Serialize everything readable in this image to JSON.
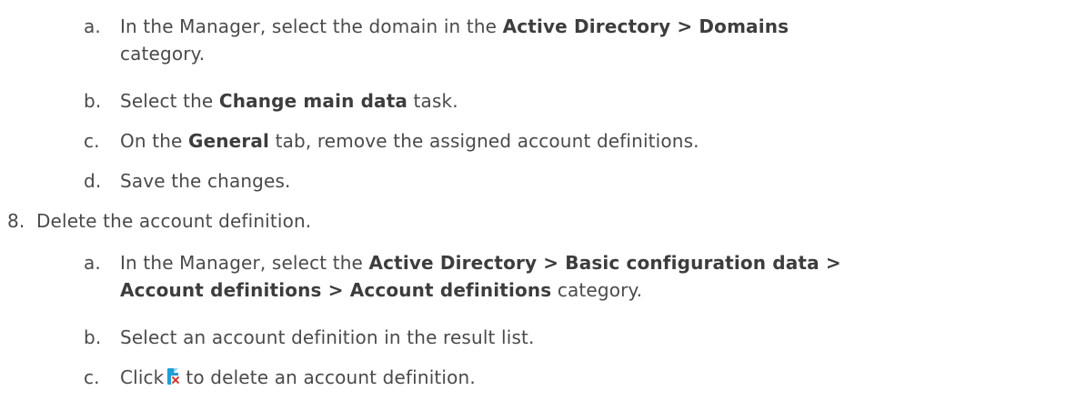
{
  "steps": {
    "sub_a1": {
      "marker": "a.",
      "pre": "In the Manager, select the domain in the ",
      "bold": "Active Directory > Domains",
      "post_line1": "",
      "line2": "category."
    },
    "sub_b1": {
      "marker": "b.",
      "pre": "Select the ",
      "bold": "Change main data",
      "post": " task."
    },
    "sub_c1": {
      "marker": "c.",
      "pre": "On the ",
      "bold": "General",
      "post": " tab, remove the assigned account definitions."
    },
    "sub_d1": {
      "marker": "d.",
      "text": "Save the changes."
    },
    "step8": {
      "marker": "8.",
      "text": "Delete the account definition."
    },
    "sub_a2": {
      "marker": "a.",
      "pre": "In the Manager, select the ",
      "bold_line1": "Active Directory > Basic configuration data >",
      "bold_line2": "Account definitions > Account definitions",
      "post": " category."
    },
    "sub_b2": {
      "marker": "b.",
      "text": "Select an account definition in the result list."
    },
    "sub_c2": {
      "marker": "c.",
      "pre": "Click",
      "icon": "delete-account-definition-icon",
      "post": "to delete an account definition."
    }
  },
  "colors": {
    "text": "#4a4a4a",
    "icon_blue": "#1d9fd8",
    "icon_red": "#d9372a"
  }
}
